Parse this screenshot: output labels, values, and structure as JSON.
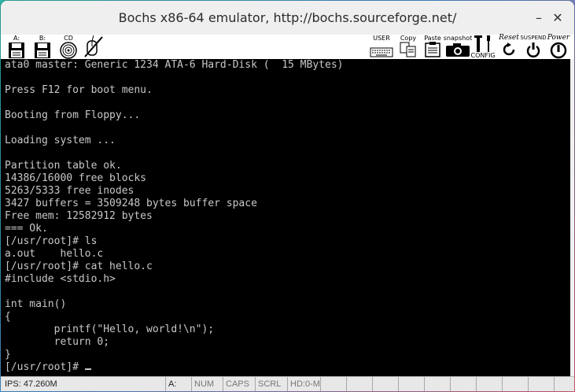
{
  "window": {
    "title": "Bochs x86-64 emulator, http://bochs.sourceforge.net/",
    "minimize_glyph": "–",
    "close_glyph": "✕"
  },
  "toolbar": {
    "floppy_a_label": "A:",
    "floppy_b_label": "B:",
    "cdrom_label": "CD",
    "user_label": "USER",
    "copy_label": "Copy",
    "paste_label": "Paste",
    "snapshot_label": "snapshot",
    "config_label": "CONFIG",
    "reset_label": "Reset",
    "suspend_label": "SUSPEND",
    "power_label": "Power"
  },
  "console": {
    "lines": [
      "ata0 master: Generic 1234 ATA-6 Hard-Disk (  15 MBytes)",
      "",
      "Press F12 for boot menu.",
      "",
      "Booting from Floppy...",
      "",
      "Loading system ...",
      "",
      "Partition table ok.",
      "14386/16000 free blocks",
      "5263/5333 free inodes",
      "3427 buffers = 3509248 bytes buffer space",
      "Free mem: 12582912 bytes",
      "=== Ok.",
      "[/usr/root]# ls",
      "a.out    hello.c",
      "[/usr/root]# cat hello.c",
      "#include <stdio.h>",
      "",
      "int main()",
      "{",
      "        printf(\"Hello, world!\\n\");",
      "        return 0;",
      "}"
    ],
    "prompt": "[/usr/root]# "
  },
  "status": {
    "ips": "IPS: 47.260M",
    "drive": "A:",
    "num": "NUM",
    "caps": "CAPS",
    "scrl": "SCRL",
    "hd": "HD:0-M"
  },
  "colors": {
    "terminal_bg": "#000000",
    "terminal_fg": "#c8c8c8"
  }
}
